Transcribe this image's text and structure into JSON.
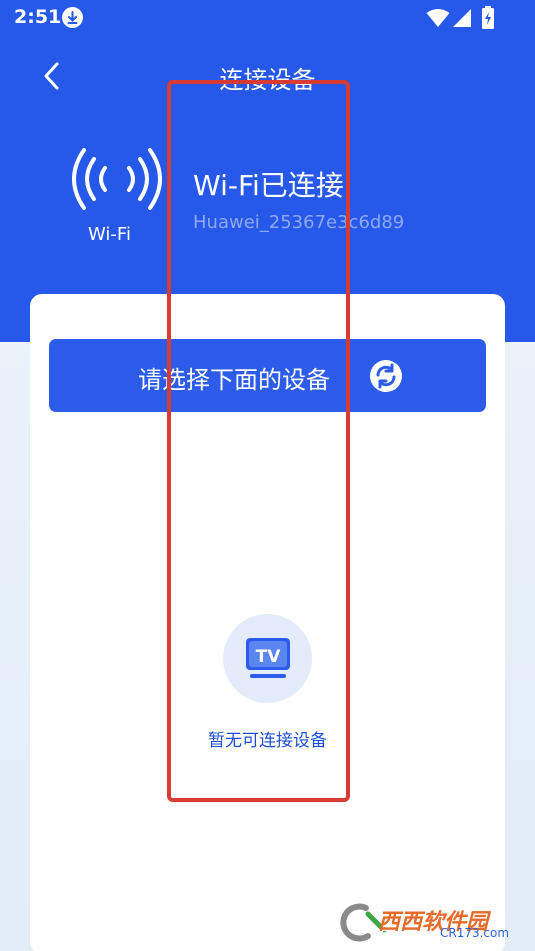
{
  "status_bar": {
    "time": "2:51",
    "icons": [
      "download-icon",
      "wifi-icon",
      "signal-icon",
      "battery-icon"
    ]
  },
  "nav": {
    "title": "连接设备",
    "back_icon": "back-arrow-icon"
  },
  "wifi": {
    "emblem_label": "Wi-Fi",
    "status": "Wi-Fi已连接",
    "ssid": "Huawei_25367e3c6d89"
  },
  "device_panel": {
    "select_button_label": "请选择下面的设备",
    "refresh_icon": "refresh-icon",
    "empty_icon": "tv-icon",
    "empty_text": "暂无可连接设备"
  },
  "watermark": {
    "text": "西西软件园",
    "sub": "CR173.com"
  },
  "colors": {
    "header_blue": "#2658ea",
    "button_blue": "#2c5ce9",
    "empty_text": "#1d4fd6",
    "annotation_red": "#d83a34"
  }
}
